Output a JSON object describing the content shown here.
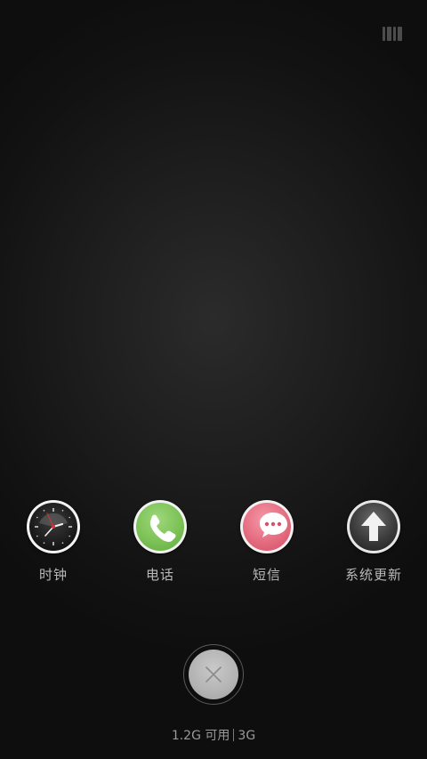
{
  "recents": {
    "apps": [
      {
        "label": "时钟",
        "icon": "clock-icon",
        "color": "#161616"
      },
      {
        "label": "电话",
        "icon": "phone-icon",
        "color": "#7cc257"
      },
      {
        "label": "短信",
        "icon": "sms-icon",
        "color": "#e56c80"
      },
      {
        "label": "系统更新",
        "icon": "update-icon",
        "color": "#3b3b3b"
      }
    ]
  },
  "close_button": {
    "icon": "close-icon"
  },
  "top_toggle": {
    "icon": "view-toggle-icon"
  },
  "status": {
    "memory_available": "1.2G 可用",
    "memory_total": "3G"
  }
}
